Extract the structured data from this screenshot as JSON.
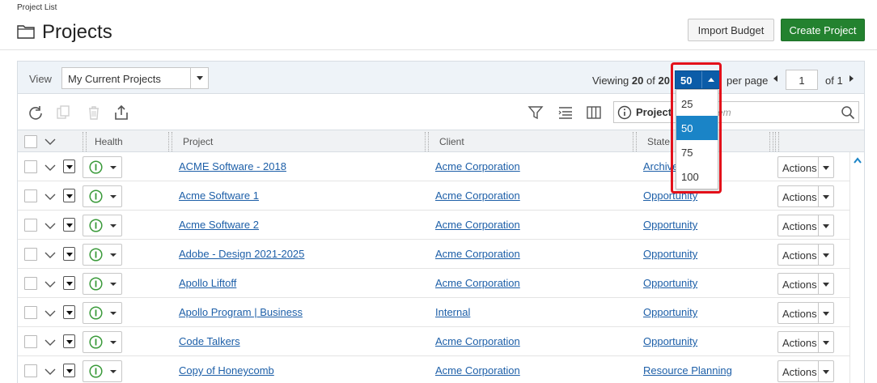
{
  "header": {
    "breadcrumb": "Project List",
    "title": "Projects",
    "import_label": "Import Budget",
    "create_label": "Create Project"
  },
  "colors": {
    "accent_blue": "#0c5ca8",
    "create_green": "#23822f",
    "link_blue": "#1d5fa8",
    "highlight_red": "#e3101a",
    "health_green": "#3a9a3a"
  },
  "viewbar": {
    "view_label": "View",
    "view_value": "My Current Projects",
    "viewing_prefix": "Viewing",
    "viewing_count": "20",
    "viewing_of": "of",
    "viewing_total": "20",
    "per_page_value": "50",
    "per_page_label": "per page",
    "page_value": "1",
    "page_of": "of 1"
  },
  "per_page_options": [
    "25",
    "50",
    "75",
    "100"
  ],
  "toolbar": {
    "icons": [
      "refresh-icon",
      "copy-icon",
      "delete-icon",
      "export-icon",
      "filter-icon",
      "list-settings-icon",
      "columns-icon",
      "info-icon",
      "search-icon"
    ],
    "search_scope": "Project",
    "search_placeholder": "em"
  },
  "table": {
    "columns": [
      "Health",
      "Project",
      "Client",
      "State"
    ],
    "actions_label": "Actions",
    "rows": [
      {
        "project": "ACME Software - 2018",
        "client": "Acme Corporation",
        "state": "Archive"
      },
      {
        "project": "Acme Software 1",
        "client": "Acme Corporation",
        "state": "Opportunity"
      },
      {
        "project": "Acme Software 2",
        "client": "Acme Corporation",
        "state": "Opportunity"
      },
      {
        "project": "Adobe - Design 2021-2025",
        "client": "Acme Corporation",
        "state": "Opportunity"
      },
      {
        "project": "Apollo Liftoff",
        "client": "Acme Corporation",
        "state": "Opportunity"
      },
      {
        "project": "Apollo Program | Business",
        "client": "Internal",
        "state": "Opportunity"
      },
      {
        "project": "Code Talkers",
        "client": "Acme Corporation",
        "state": "Opportunity"
      },
      {
        "project": "Copy of Honeycomb",
        "client": "Acme Corporation",
        "state": "Resource Planning"
      }
    ]
  }
}
